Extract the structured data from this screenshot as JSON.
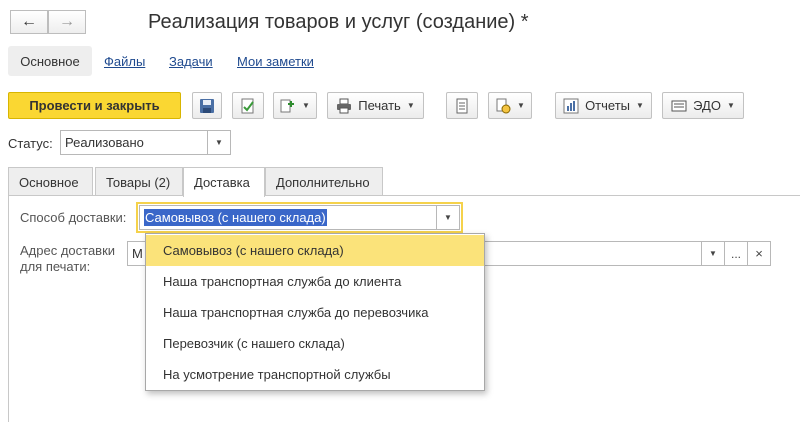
{
  "window": {
    "title": "Реализация товаров и услуг (создание) *"
  },
  "nav": {
    "back_glyph": "←",
    "forward_glyph": "→"
  },
  "top_tabs": [
    {
      "label": "Основное"
    },
    {
      "label": "Файлы"
    },
    {
      "label": "Задачи"
    },
    {
      "label": "Мои заметки"
    }
  ],
  "toolbar": {
    "post_close_label": "Провести и закрыть",
    "print_label": "Печать",
    "reports_label": "Отчеты",
    "edo_label": "ЭДО",
    "accent_color": "#fad732"
  },
  "status": {
    "label": "Статус:",
    "value": "Реализовано"
  },
  "tabs": [
    {
      "label": "Основное"
    },
    {
      "label": "Товары (2)"
    },
    {
      "label": "Доставка"
    },
    {
      "label": "Дополнительно"
    }
  ],
  "delivery": {
    "method_label": "Способ доставки:",
    "method_value": "Самовывоз (с нашего склада)",
    "address_label_line1": "Адрес доставки",
    "address_label_line2": "для печати:",
    "address_value_partial": "М",
    "ellipsis": "...",
    "clear": "×"
  },
  "dropdown": {
    "options": [
      "Самовывоз (с нашего склада)",
      "Наша транспортная служба до клиента",
      "Наша транспортная служба до перевозчика",
      "Перевозчик (с нашего склада)",
      "На усмотрение транспортной службы"
    ],
    "selected_index": 0
  }
}
